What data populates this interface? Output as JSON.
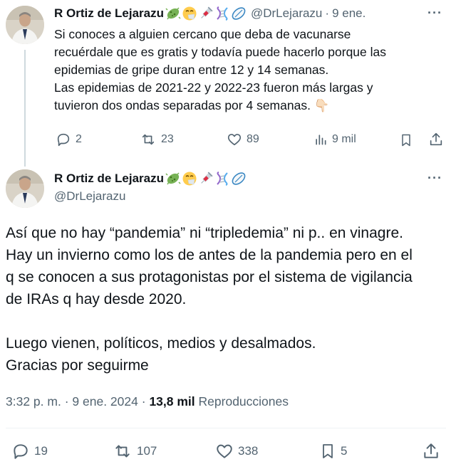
{
  "tweet1": {
    "author_name": "R Ortiz de Lejarazu",
    "emojis": [
      "microbe-emoji",
      "sneezing-face-emoji",
      "syringe-emoji",
      "dna-emoji",
      "rugby-ball-emoji"
    ],
    "handle": "@DrLejarazu",
    "date": "9 ene.",
    "text_lines": [
      "Si conoces a alguien cercano que deba de vacunarse",
      "recuérdale que es gratis y todavía puede hacerlo porque las",
      "epidemias de gripe duran entre 12 y 14 semanas.",
      "Las epidemias de 2021-22 y 2022-23 fueron más largas y",
      "tuvieron dos ondas separadas por 4 semanas. 👇🏻"
    ],
    "replies": "2",
    "reposts": "23",
    "likes": "89",
    "views": "9 mil"
  },
  "tweet2": {
    "author_name": "R Ortiz de Lejarazu",
    "handle": "@DrLejarazu",
    "text_lines": [
      "Así que no hay “pandemia” ni “tripledemia” ni p.. en vinagre.",
      "Hay un invierno como los de antes de la pandemia pero en el",
      "q se conocen a sus protagonistas por el sistema de vigilancia",
      "de IRAs q hay desde 2020.",
      "",
      "Luego vienen, políticos, medios y desalmados.",
      "Gracias por seguirme"
    ],
    "time": "3:32 p. m.",
    "date": "9 ene. 2024",
    "views_count": "13,8 mil",
    "views_label": "Reproducciones",
    "replies": "19",
    "reposts": "107",
    "likes": "338",
    "bookmarks": "5"
  },
  "colors": {
    "text": "#0f1419",
    "secondary": "#536471",
    "divider": "#eff3f4",
    "thread_line": "#cfd9de"
  }
}
